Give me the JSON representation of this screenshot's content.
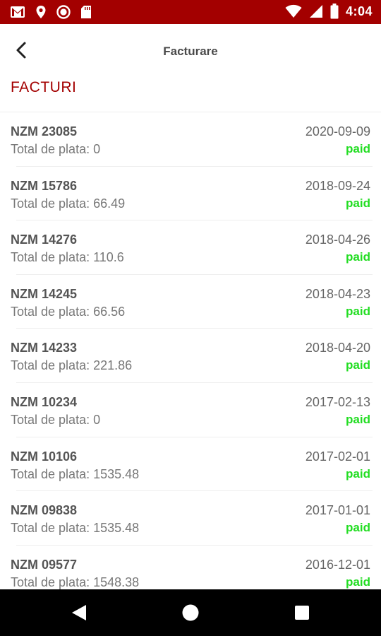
{
  "status_bar": {
    "time": "4:04",
    "accent": "#a30000"
  },
  "header": {
    "title": "Facturare",
    "back_icon": "arrow-left-icon"
  },
  "section": {
    "title": "FACTURI"
  },
  "invoices": [
    {
      "number": "NZM 23085",
      "total": "Total de plata: 0",
      "date": "2020-09-09",
      "status": "paid"
    },
    {
      "number": "NZM 15786",
      "total": "Total de plata: 66.49",
      "date": "2018-09-24",
      "status": "paid"
    },
    {
      "number": "NZM 14276",
      "total": "Total de plata: 110.6",
      "date": "2018-04-26",
      "status": "paid"
    },
    {
      "number": "NZM 14245",
      "total": "Total de plata: 66.56",
      "date": "2018-04-23",
      "status": "paid"
    },
    {
      "number": "NZM 14233",
      "total": "Total de plata: 221.86",
      "date": "2018-04-20",
      "status": "paid"
    },
    {
      "number": "NZM 10234",
      "total": "Total de plata: 0",
      "date": "2017-02-13",
      "status": "paid"
    },
    {
      "number": "NZM 10106",
      "total": "Total de plata: 1535.48",
      "date": "2017-02-01",
      "status": "paid"
    },
    {
      "number": "NZM 09838",
      "total": "Total de plata: 1535.48",
      "date": "2017-01-01",
      "status": "paid"
    },
    {
      "number": "NZM 09577",
      "total": "Total de plata: 1548.38",
      "date": "2016-12-01",
      "status": "paid"
    }
  ],
  "colors": {
    "paid": "#22dd22",
    "accent": "#a30000"
  }
}
